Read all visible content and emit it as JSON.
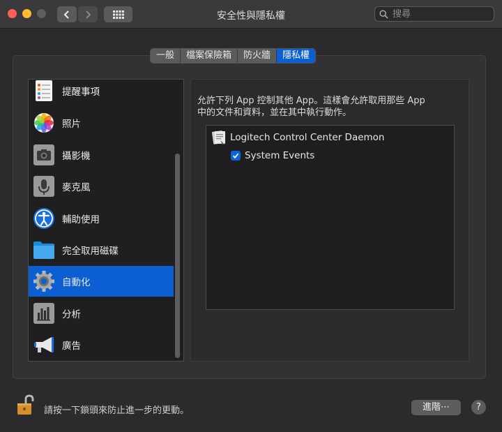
{
  "window": {
    "title": "安全性與隱私權",
    "search_placeholder": "搜尋"
  },
  "tabs": [
    {
      "label": "一般",
      "active": false
    },
    {
      "label": "檔案保險箱",
      "active": false
    },
    {
      "label": "防火牆",
      "active": false
    },
    {
      "label": "隱私權",
      "active": true
    }
  ],
  "sidebar": {
    "items": [
      {
        "label": "提醒事項",
        "icon": "reminders-icon"
      },
      {
        "label": "照片",
        "icon": "photos-icon"
      },
      {
        "label": "攝影機",
        "icon": "camera-icon"
      },
      {
        "label": "麥克風",
        "icon": "microphone-icon"
      },
      {
        "label": "輔助使用",
        "icon": "accessibility-icon"
      },
      {
        "label": "完全取用磁碟",
        "icon": "folder-icon"
      },
      {
        "label": "自動化",
        "icon": "gear-icon",
        "selected": true
      },
      {
        "label": "分析",
        "icon": "analytics-icon"
      },
      {
        "label": "廣告",
        "icon": "megaphone-icon"
      }
    ]
  },
  "main": {
    "description_line1": "允許下列 App 控制其他 App。這樣會允許取用那些 App",
    "description_line2": "中的文件和資料，並在其中執行動作。",
    "apps": [
      {
        "name": "Logitech Control Center Daemon",
        "children": [
          {
            "name": "System Events",
            "checked": true
          }
        ]
      }
    ]
  },
  "footer": {
    "lock_text": "請按一下鎖頭來防止進一步的更動。",
    "advanced_label": "進階⋯",
    "help_label": "?"
  },
  "colors": {
    "accent": "#0b5fd3",
    "window_bg": "#2b2b2d"
  }
}
